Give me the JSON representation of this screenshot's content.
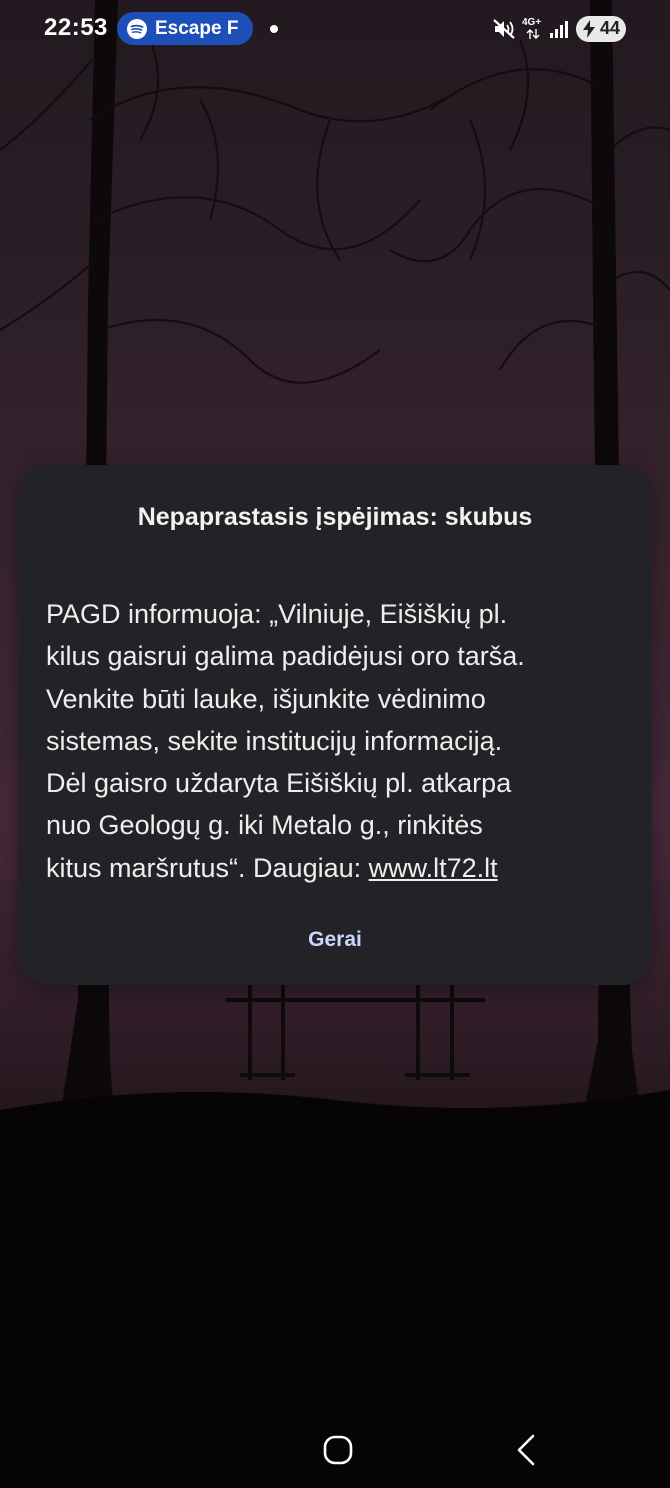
{
  "status_bar": {
    "time": "22:53",
    "media_chip": {
      "app_icon": "spotify-icon",
      "label": "Escape F",
      "color": "#1c4fb8"
    },
    "network_type": "4G+",
    "battery_level": "44",
    "icons": [
      "mute-icon",
      "signal-icon",
      "battery-charging-icon"
    ]
  },
  "alert": {
    "title": "Nepaprastasis įspėjimas: skubus",
    "body_lines": [
      "PAGD informuoja: „Vilniuje, Eišiškių pl.",
      "kilus gaisrui galima padidėjusi oro tarša.",
      "Venkite būti lauke, išjunkite vėdinimo",
      "sistemas, sekite institucijų informaciją.",
      "Dėl gaisro uždaryta Eišiškių pl. atkarpa",
      "nuo Geologų g. iki Metalo g., rinkitės"
    ],
    "body_last_line_prefix": "kitus maršrutus“. Daugiau: ",
    "link_text": "www.lt72.lt",
    "button_label": "Gerai",
    "background_color": "#232226"
  },
  "navigation": {
    "icons": [
      "home-icon",
      "back-icon"
    ]
  }
}
